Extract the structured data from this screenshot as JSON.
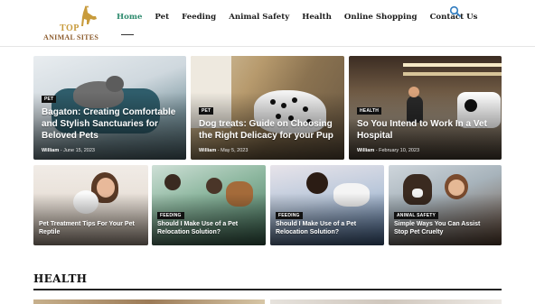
{
  "header": {
    "logo_top": "TOP",
    "logo_main": "ANIMAL SITES",
    "nav": [
      "Home",
      "Pet",
      "Feeding",
      "Animal Safety",
      "Health",
      "Online Shopping",
      "Contact Us"
    ],
    "active_nav": "Home",
    "search_icon": "search-icon"
  },
  "featured": [
    {
      "badge": "PET",
      "title": "Bagaton: Creating Comfortable and Stylish Sanctuaries for Beloved Pets",
      "author": "William",
      "date": "June 15, 2023"
    },
    {
      "badge": "PET",
      "title": "Dog treats: Guide on Choosing the Right Delicacy for your Pup",
      "author": "William",
      "date": "May 5, 2023"
    },
    {
      "badge": "HEALTH",
      "title": "So You Intend to Work In a Vet Hospital",
      "author": "William",
      "date": "February 10, 2023"
    }
  ],
  "grid": [
    {
      "badge": "",
      "title": "Pet Treatment Tips For Your Pet Reptile"
    },
    {
      "badge": "FEEDING",
      "title": "Should I Make Use of a Pet Relocation Solution?"
    },
    {
      "badge": "FEEDING",
      "title": "Should I Make Use of a Pet Relocation Solution?"
    },
    {
      "badge": "ANIMAL SAFETY",
      "title": "Simple Ways You Can Assist Stop Pet Cruelty"
    }
  ],
  "section": {
    "title": "HEALTH"
  },
  "colors": {
    "accent": "#2e8b6e",
    "logo_gold": "#c89b3c",
    "logo_brown": "#8b5a2b"
  }
}
